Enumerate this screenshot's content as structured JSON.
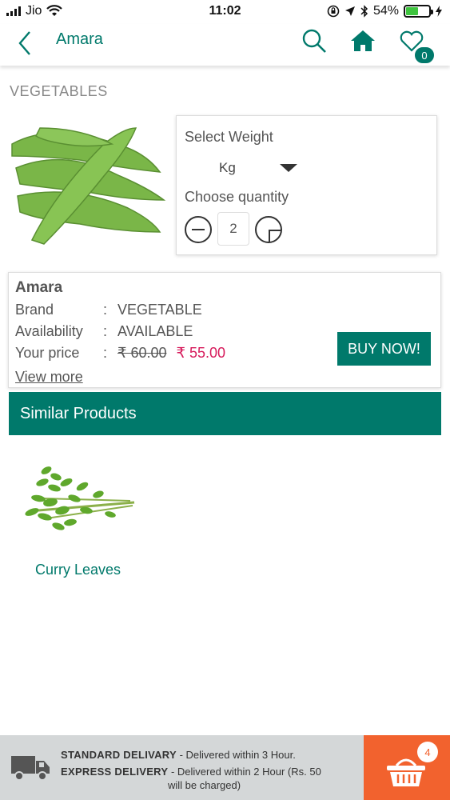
{
  "status_bar": {
    "carrier": "Jio",
    "time": "11:02",
    "battery_percent": "54%",
    "battery_level": 0.54
  },
  "header": {
    "title": "Amara",
    "cart_count": "0",
    "accent_color": "#00796b"
  },
  "section_label": "VEGETABLES",
  "options": {
    "select_weight_label": "Select  Weight",
    "weight_value": "Kg",
    "choose_quantity_label": "Choose quantity",
    "quantity": "2"
  },
  "details": {
    "name": "Amara",
    "rows": [
      {
        "label": "Brand",
        "sep": ":",
        "value": "VEGETABLE"
      },
      {
        "label": "Availability",
        "sep": ":",
        "value": "AVAILABLE"
      },
      {
        "label": "Your price",
        "sep": ":"
      }
    ],
    "old_price": "₹ 60.00",
    "new_price": "₹ 55.00",
    "price_color": "#d6195a",
    "view_more": "View more",
    "buy_now": "BUY NOW!"
  },
  "similar": {
    "title": "Similar Products",
    "items": [
      {
        "name": "Curry Leaves"
      }
    ]
  },
  "delivery": {
    "standard_label": "STANDARD DELIVARY",
    "standard_text": " - Delivered within 3 Hour.",
    "express_label": "EXPRESS DELIVERY",
    "express_text": " - Delivered within 2  Hour (Rs. 50",
    "express_text_2": "will be charged)",
    "basket_count": "4",
    "basket_color": "#f2622e"
  },
  "icons": [
    "back-arrow-icon",
    "search-icon",
    "home-icon",
    "heart-icon",
    "minus-icon",
    "plus-icon",
    "truck-icon",
    "basket-icon"
  ]
}
